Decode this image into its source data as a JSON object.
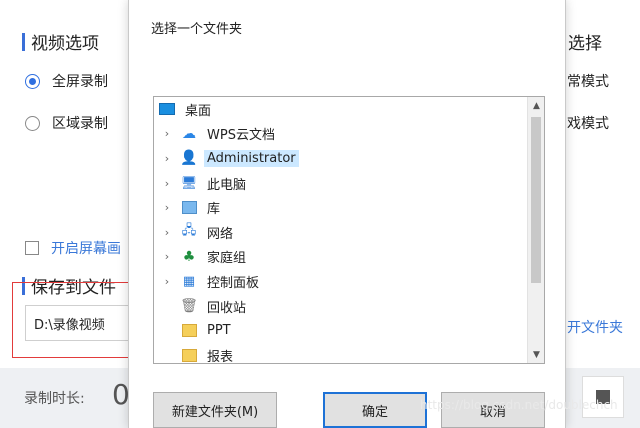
{
  "background_app": {
    "video_options_title": "视频选项",
    "fullscreen_record": "全屏录制",
    "area_record": "区域录制",
    "enable_screen_checkbox": "开启屏幕画",
    "save_to_file_title": "保存到文件",
    "save_path": "D:\\录像视频",
    "right_title": "选择",
    "right_mode_1": "常模式",
    "right_mode_2": "戏模式",
    "open_folder_link": "开文件夹",
    "duration_label": "录制时长:",
    "duration_value": "0"
  },
  "dialog": {
    "prompt": "选择一个文件夹",
    "tree": [
      {
        "label": "桌面",
        "icon": "desktop-icon",
        "level": "root",
        "chevron": false,
        "selected": false
      },
      {
        "label": "WPS云文档",
        "icon": "cloud-icon",
        "level": "child",
        "chevron": true,
        "selected": false
      },
      {
        "label": "Administrator",
        "icon": "user-icon",
        "level": "child",
        "chevron": true,
        "selected": true
      },
      {
        "label": "此电脑",
        "icon": "computer-icon",
        "level": "child",
        "chevron": true,
        "selected": false
      },
      {
        "label": "库",
        "icon": "library-icon",
        "level": "child",
        "chevron": true,
        "selected": false
      },
      {
        "label": "网络",
        "icon": "network-icon",
        "level": "child",
        "chevron": true,
        "selected": false
      },
      {
        "label": "家庭组",
        "icon": "homegroup-icon",
        "level": "child",
        "chevron": true,
        "selected": false
      },
      {
        "label": "控制面板",
        "icon": "control-panel-icon",
        "level": "child",
        "chevron": true,
        "selected": false
      },
      {
        "label": "回收站",
        "icon": "recycle-bin-icon",
        "level": "child",
        "chevron": false,
        "selected": false
      },
      {
        "label": "PPT",
        "icon": "folder-icon",
        "level": "child",
        "chevron": false,
        "selected": false
      },
      {
        "label": "报表",
        "icon": "folder-icon",
        "level": "child",
        "chevron": false,
        "selected": false
      }
    ],
    "new_folder_button": "新建文件夹(M)",
    "ok_button": "确定",
    "cancel_button": "取消"
  },
  "watermark": "https://blog.csdn.net/doublechch",
  "colors": {
    "accent": "#2f6fe0",
    "selection": "#cce8ff",
    "warning_border": "#e23b3b"
  }
}
